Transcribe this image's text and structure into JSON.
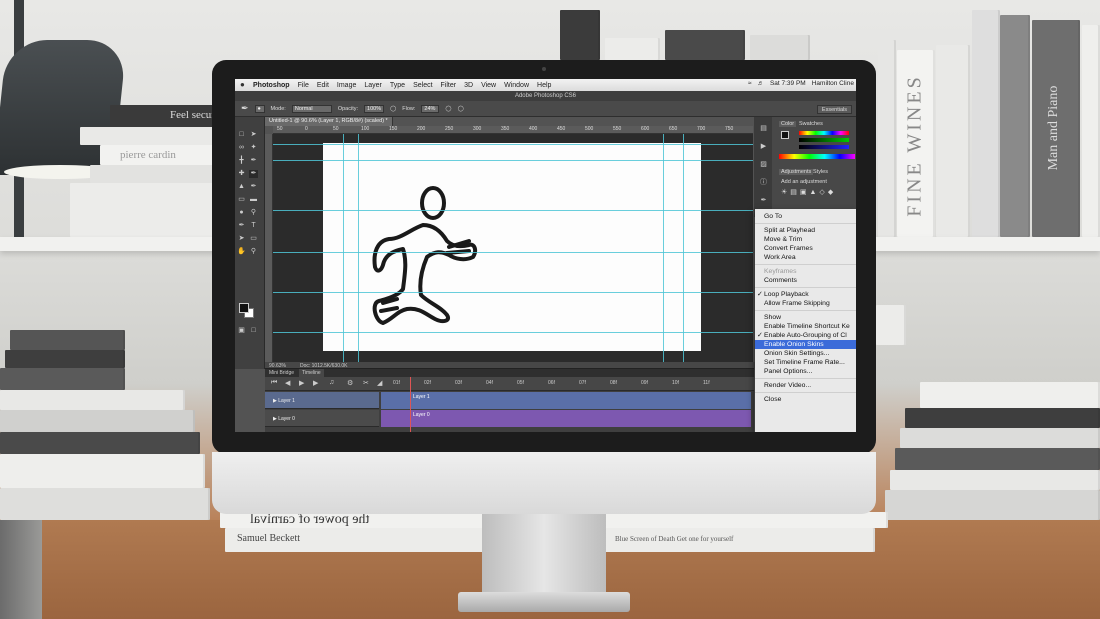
{
  "menubar": {
    "app": "Photoshop",
    "items": [
      "File",
      "Edit",
      "Image",
      "Layer",
      "Type",
      "Select",
      "Filter",
      "3D",
      "View",
      "Window",
      "Help"
    ],
    "clock": "Sat 7:39 PM",
    "user": "Hamilton Cline"
  },
  "window_title": "Adobe Photoshop CS6",
  "options": {
    "mode_label": "Mode:",
    "mode_value": "Normal",
    "opacity_label": "Opacity:",
    "opacity_value": "100%",
    "flow_label": "Flow:",
    "flow_value": "24%",
    "workspace": "Essentials"
  },
  "document": {
    "tab": "Untitled-1 @ 90.6% (Layer 1, RGB/8#) (scaled) *",
    "ruler_marks": [
      "50",
      "0",
      "50",
      "100",
      "150",
      "200",
      "250",
      "300",
      "350",
      "400",
      "450",
      "500",
      "550",
      "600",
      "650",
      "700",
      "750"
    ],
    "zoom": "90.63%",
    "doc_size": "Doc: 1012.5K/630.0K"
  },
  "panels": {
    "color_tab": "Color",
    "swatches_tab": "Swatches",
    "adjustments_tab": "Adjustments",
    "styles_tab": "Styles",
    "add_adjustment": "Add an adjustment"
  },
  "timeline": {
    "tabs": [
      "Mini Bridge",
      "Timeline"
    ],
    "time_marks": [
      "01f",
      "02f",
      "03f",
      "04f",
      "05f",
      "06f",
      "07f",
      "08f",
      "09f",
      "10f",
      "11f"
    ],
    "tracks": [
      {
        "name": "Layer 1",
        "clip": "Layer 1",
        "color": "#5a6fa8"
      },
      {
        "name": "Layer 0",
        "clip": "Layer 0",
        "color": "#7d58b0"
      }
    ]
  },
  "context_menu": {
    "items": [
      {
        "label": "Go To",
        "checked": false,
        "disabled": false,
        "selected": false
      },
      {
        "label": "Split at Playhead",
        "checked": false,
        "disabled": false,
        "selected": false
      },
      {
        "label": "Move & Trim",
        "checked": false,
        "disabled": false,
        "selected": false
      },
      {
        "label": "Convert Frames",
        "checked": false,
        "disabled": false,
        "selected": false
      },
      {
        "label": "Work Area",
        "checked": false,
        "disabled": false,
        "selected": false
      },
      {
        "label": "Keyframes",
        "checked": false,
        "disabled": true,
        "selected": false
      },
      {
        "label": "Comments",
        "checked": false,
        "disabled": false,
        "selected": false
      },
      {
        "label": "Loop Playback",
        "checked": true,
        "disabled": false,
        "selected": false
      },
      {
        "label": "Allow Frame Skipping",
        "checked": false,
        "disabled": false,
        "selected": false
      },
      {
        "label": "Show",
        "checked": false,
        "disabled": false,
        "selected": false
      },
      {
        "label": "Enable Timeline Shortcut Ke",
        "checked": false,
        "disabled": false,
        "selected": false
      },
      {
        "label": "Enable Auto-Grouping of Cl",
        "checked": true,
        "disabled": false,
        "selected": false
      },
      {
        "label": "Enable Onion Skins",
        "checked": false,
        "disabled": false,
        "selected": true
      },
      {
        "label": "Onion Skin Settings...",
        "checked": false,
        "disabled": false,
        "selected": false
      },
      {
        "label": "Set Timeline Frame Rate...",
        "checked": false,
        "disabled": false,
        "selected": false
      },
      {
        "label": "Panel Options...",
        "checked": false,
        "disabled": false,
        "selected": false
      },
      {
        "label": "Render Video...",
        "checked": false,
        "disabled": false,
        "selected": false
      },
      {
        "label": "Close",
        "checked": false,
        "disabled": false,
        "selected": false
      }
    ]
  },
  "background_books": {
    "shelf": [
      "FINE WINES",
      "Man and Piano",
      "Feel secur",
      "pierre cardin"
    ],
    "desk": [
      "the power of carnival",
      "Samuel Beckett",
      "Blue Screen of Death Get one for yourself"
    ]
  },
  "colors": {
    "menu_highlight": "#3b6bd9",
    "guide": "#4fc6d6",
    "track_layer1": "#5a6fa8",
    "track_layer0": "#7d58b0"
  }
}
